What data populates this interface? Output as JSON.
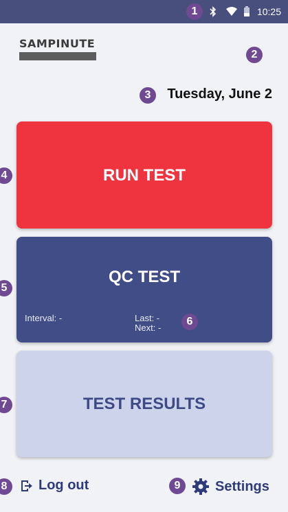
{
  "status_bar": {
    "time": "10:25",
    "icons": [
      "bluetooth-icon",
      "wifi-icon",
      "battery-icon"
    ],
    "background": "#484f7d"
  },
  "logo": {
    "text": "SAMPINUTE"
  },
  "date": "Tuesday, June 2",
  "cards": {
    "run_test": {
      "label": "RUN TEST",
      "color": "#ef333f"
    },
    "qc_test": {
      "label": "QC TEST",
      "interval": "Interval: -",
      "last": "Last: -",
      "next": "Next: -",
      "color": "#414d87"
    },
    "test_results": {
      "label": "TEST RESULTS",
      "color": "#ccd3eb"
    }
  },
  "footer": {
    "logout_label": "Log out",
    "settings_label": "Settings"
  },
  "markers": [
    "1",
    "2",
    "3",
    "4",
    "5",
    "6",
    "7",
    "8",
    "9"
  ]
}
